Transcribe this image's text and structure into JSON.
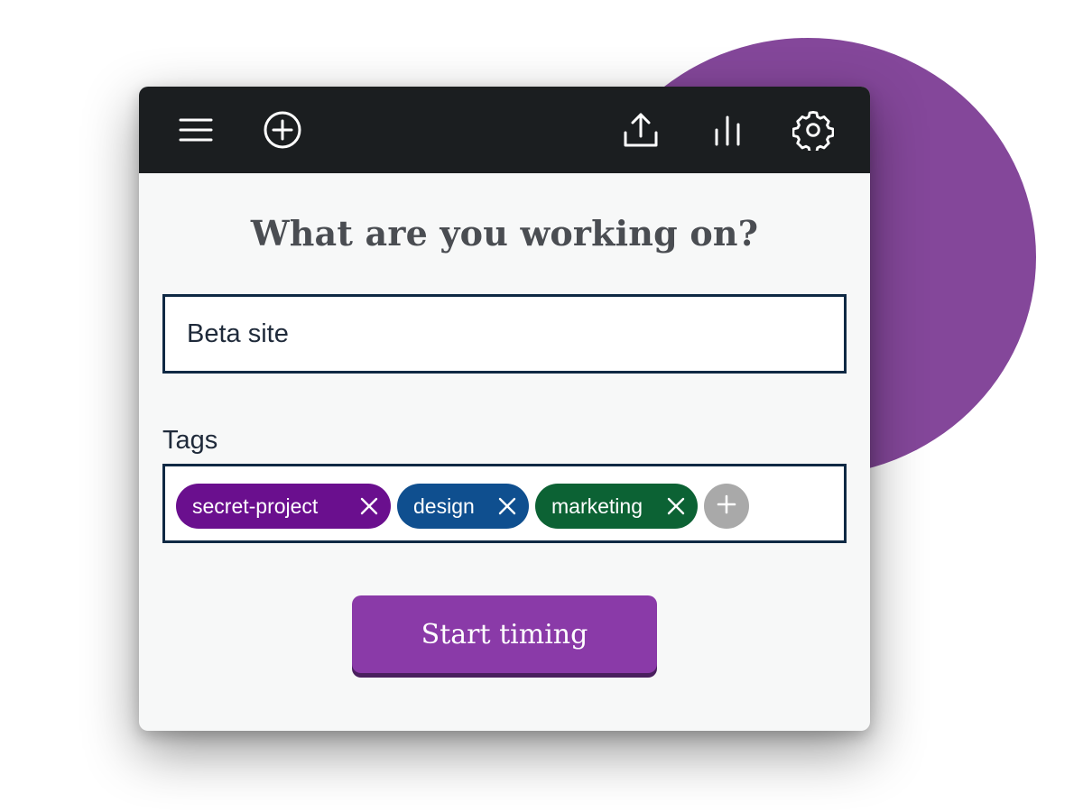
{
  "toolbar": {
    "icons": [
      "menu-icon",
      "add-circle-icon",
      "upload-icon",
      "bar-chart-icon",
      "gear-icon"
    ]
  },
  "main": {
    "heading": "What are you working on?",
    "task_value": "Beta site",
    "tags_label": "Tags",
    "tags": [
      {
        "label": "secret-project",
        "color": "#6a0f8e"
      },
      {
        "label": "design",
        "color": "#0f4f8f"
      },
      {
        "label": "marketing",
        "color": "#0c6234"
      }
    ],
    "start_label": "Start timing"
  },
  "colors": {
    "accent": "#8a3aa8",
    "toolbar_bg": "#1b1e20",
    "blob": "#84479a",
    "input_border": "#0f2944",
    "add_tag": "#a9a9a9"
  }
}
